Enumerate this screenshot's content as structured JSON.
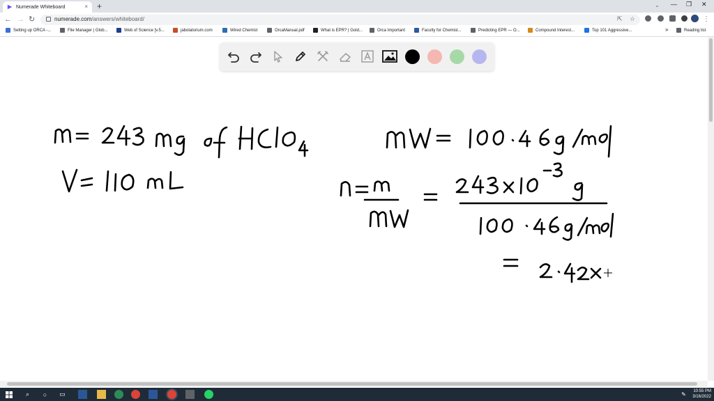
{
  "browser": {
    "tab_title": "Numerade Whiteboard",
    "tab_close": "×",
    "new_tab": "+",
    "url_host": "numerade.com",
    "url_path": "/answers/whiteboard/",
    "bookmarks": [
      {
        "label": "Setting up ORCA -...",
        "color": "#3b6fd4"
      },
      {
        "label": "File Manager | Glob...",
        "color": "#5f6368"
      },
      {
        "label": "Web of Science [v.5...",
        "color": "#1a3f8f"
      },
      {
        "label": "jabolatorium.com",
        "color": "#c94c2c"
      },
      {
        "label": "Wired Chemist",
        "color": "#2e6db4"
      },
      {
        "label": "OrcaManual.pdf",
        "color": "#5f6368"
      },
      {
        "label": "What is EPR? | Gold...",
        "color": "#202124"
      },
      {
        "label": "Orca Important",
        "color": "#5f6368"
      },
      {
        "label": "Faculty for Chemist...",
        "color": "#2a5aa0"
      },
      {
        "label": "Predicting EPR — O...",
        "color": "#5f6368"
      },
      {
        "label": "Compound Interest...",
        "color": "#d48a1a"
      },
      {
        "label": "Top 101 Aggressive...",
        "color": "#1a73e8"
      }
    ],
    "bookmarks_more": "»",
    "reading_list": "Reading list"
  },
  "whiteboard": {
    "colors": {
      "black": "#000000",
      "pink": "#f4b7b1",
      "green": "#a7d9a8",
      "purple": "#b7b7f0"
    },
    "handwriting": {
      "line1": "m = 243 mg of HClO4",
      "line2": "V = 110 mL",
      "line3": "MW = 100.46 g/mol",
      "line4_lhs": "n = m / MW",
      "line4_num": "243 x 10-3 g",
      "line4_den": "100.46 g/mol",
      "line5": "= 2.42x"
    }
  },
  "taskbar": {
    "time": "10:55 PM",
    "date": "3/16/2022"
  }
}
